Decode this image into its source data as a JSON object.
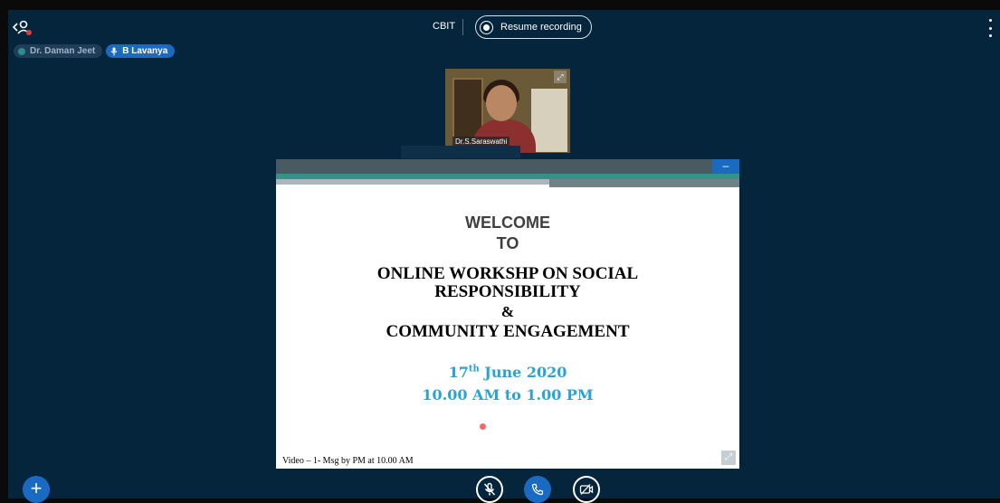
{
  "topbar": {
    "meeting_name": "CBIT",
    "record_label": "Resume recording"
  },
  "talkers": [
    {
      "name": "Dr. Daman Jeet",
      "state": "inactive"
    },
    {
      "name": "B Lavanya",
      "state": "active"
    }
  ],
  "webcam": {
    "name": "Dr.S.Saraswathi"
  },
  "presentation": {
    "line_welcome": "WELCOME",
    "line_to": "TO",
    "line_title1": "ONLINE WORKSHP ON SOCIAL",
    "line_title2": "RESPONSIBILITY",
    "line_amp": "&",
    "line_title3": "COMMUNITY ENGAGEMENT",
    "date_day": "17",
    "date_suffix": "th",
    "date_rest": " June 2020",
    "time": "10.00 AM to 1.00 PM",
    "footer_note": "Video – 1- Msg by PM at 10.00 AM"
  },
  "colors": {
    "stage_bg": "#05253d",
    "accent": "#1b6ac1",
    "slide_highlight": "#29a3d4"
  }
}
